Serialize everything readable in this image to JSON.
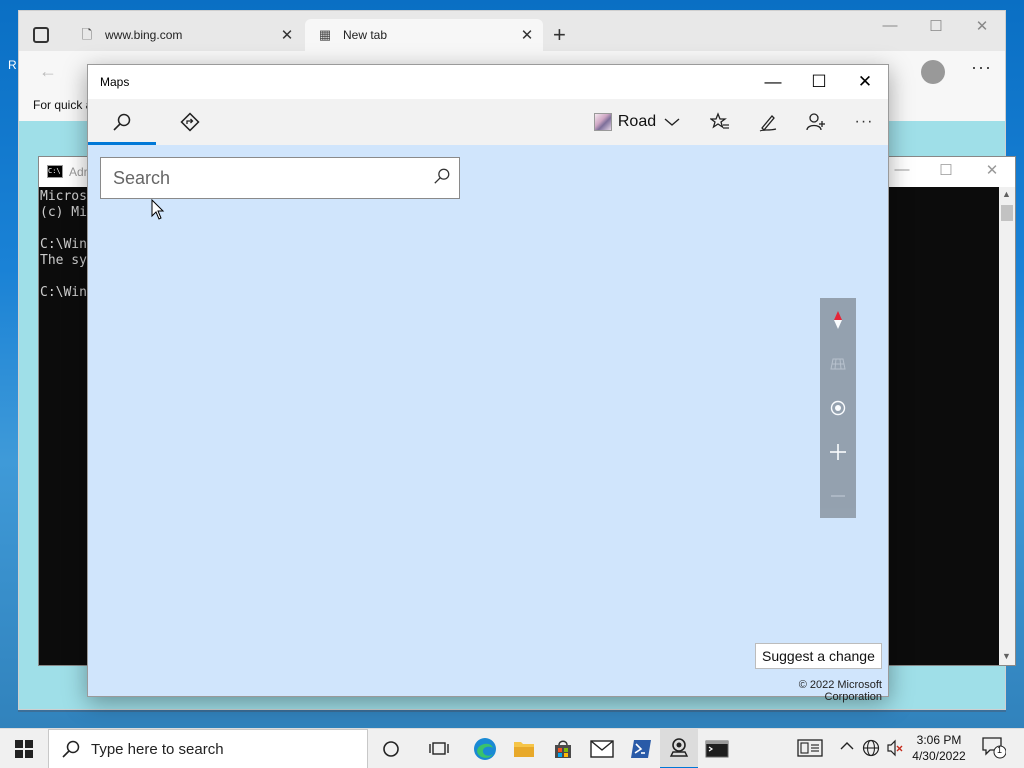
{
  "desktop": {
    "partial_label": "R"
  },
  "edge": {
    "tabs": [
      {
        "title": "www.bing.com",
        "favicon": "document-icon"
      },
      {
        "title": "New tab",
        "favicon": "newtab-icon"
      }
    ],
    "favorites_hint": "For quick a",
    "caption": {
      "minimize": "—",
      "maximize": "☐",
      "close": "✕"
    }
  },
  "cmd": {
    "title": "Adr",
    "lines": [
      "Micros",
      "(c) Mi",
      "",
      "C:\\Win",
      "The sy",
      "",
      "C:\\Win"
    ]
  },
  "maps": {
    "title": "Maps",
    "caption": {
      "minimize": "—",
      "maximize": "☐",
      "close": "✕"
    },
    "toolbar": {
      "search_tab_icon": "search-icon",
      "directions_tab_icon": "directions-icon",
      "map_style_label": "Road",
      "favorites_icon": "favorites-icon",
      "ink_icon": "pen-icon",
      "account_icon": "add-person-icon",
      "more_label": "···"
    },
    "search": {
      "placeholder": "Search",
      "value": ""
    },
    "controls": [
      "compass-icon",
      "tilt-icon",
      "location-icon",
      "zoom-in-icon",
      "zoom-out-icon"
    ],
    "suggest_change_label": "Suggest a change",
    "copyright": "© 2022 Microsoft Corporation"
  },
  "taskbar": {
    "search_placeholder": "Type here to search",
    "apps": [
      "cortana-icon",
      "task-view-icon",
      "edge-icon",
      "file-explorer-icon",
      "store-icon",
      "mail-icon",
      "powershell-icon",
      "maps-icon",
      "terminal-icon"
    ],
    "active_app": "maps-icon",
    "clock": {
      "time": "3:06 PM",
      "date": "4/30/2022"
    },
    "notification_count": "1"
  },
  "colors": {
    "accent": "#0078d7",
    "map_background": "#d0e5fc",
    "compass_red": "#e81123"
  }
}
